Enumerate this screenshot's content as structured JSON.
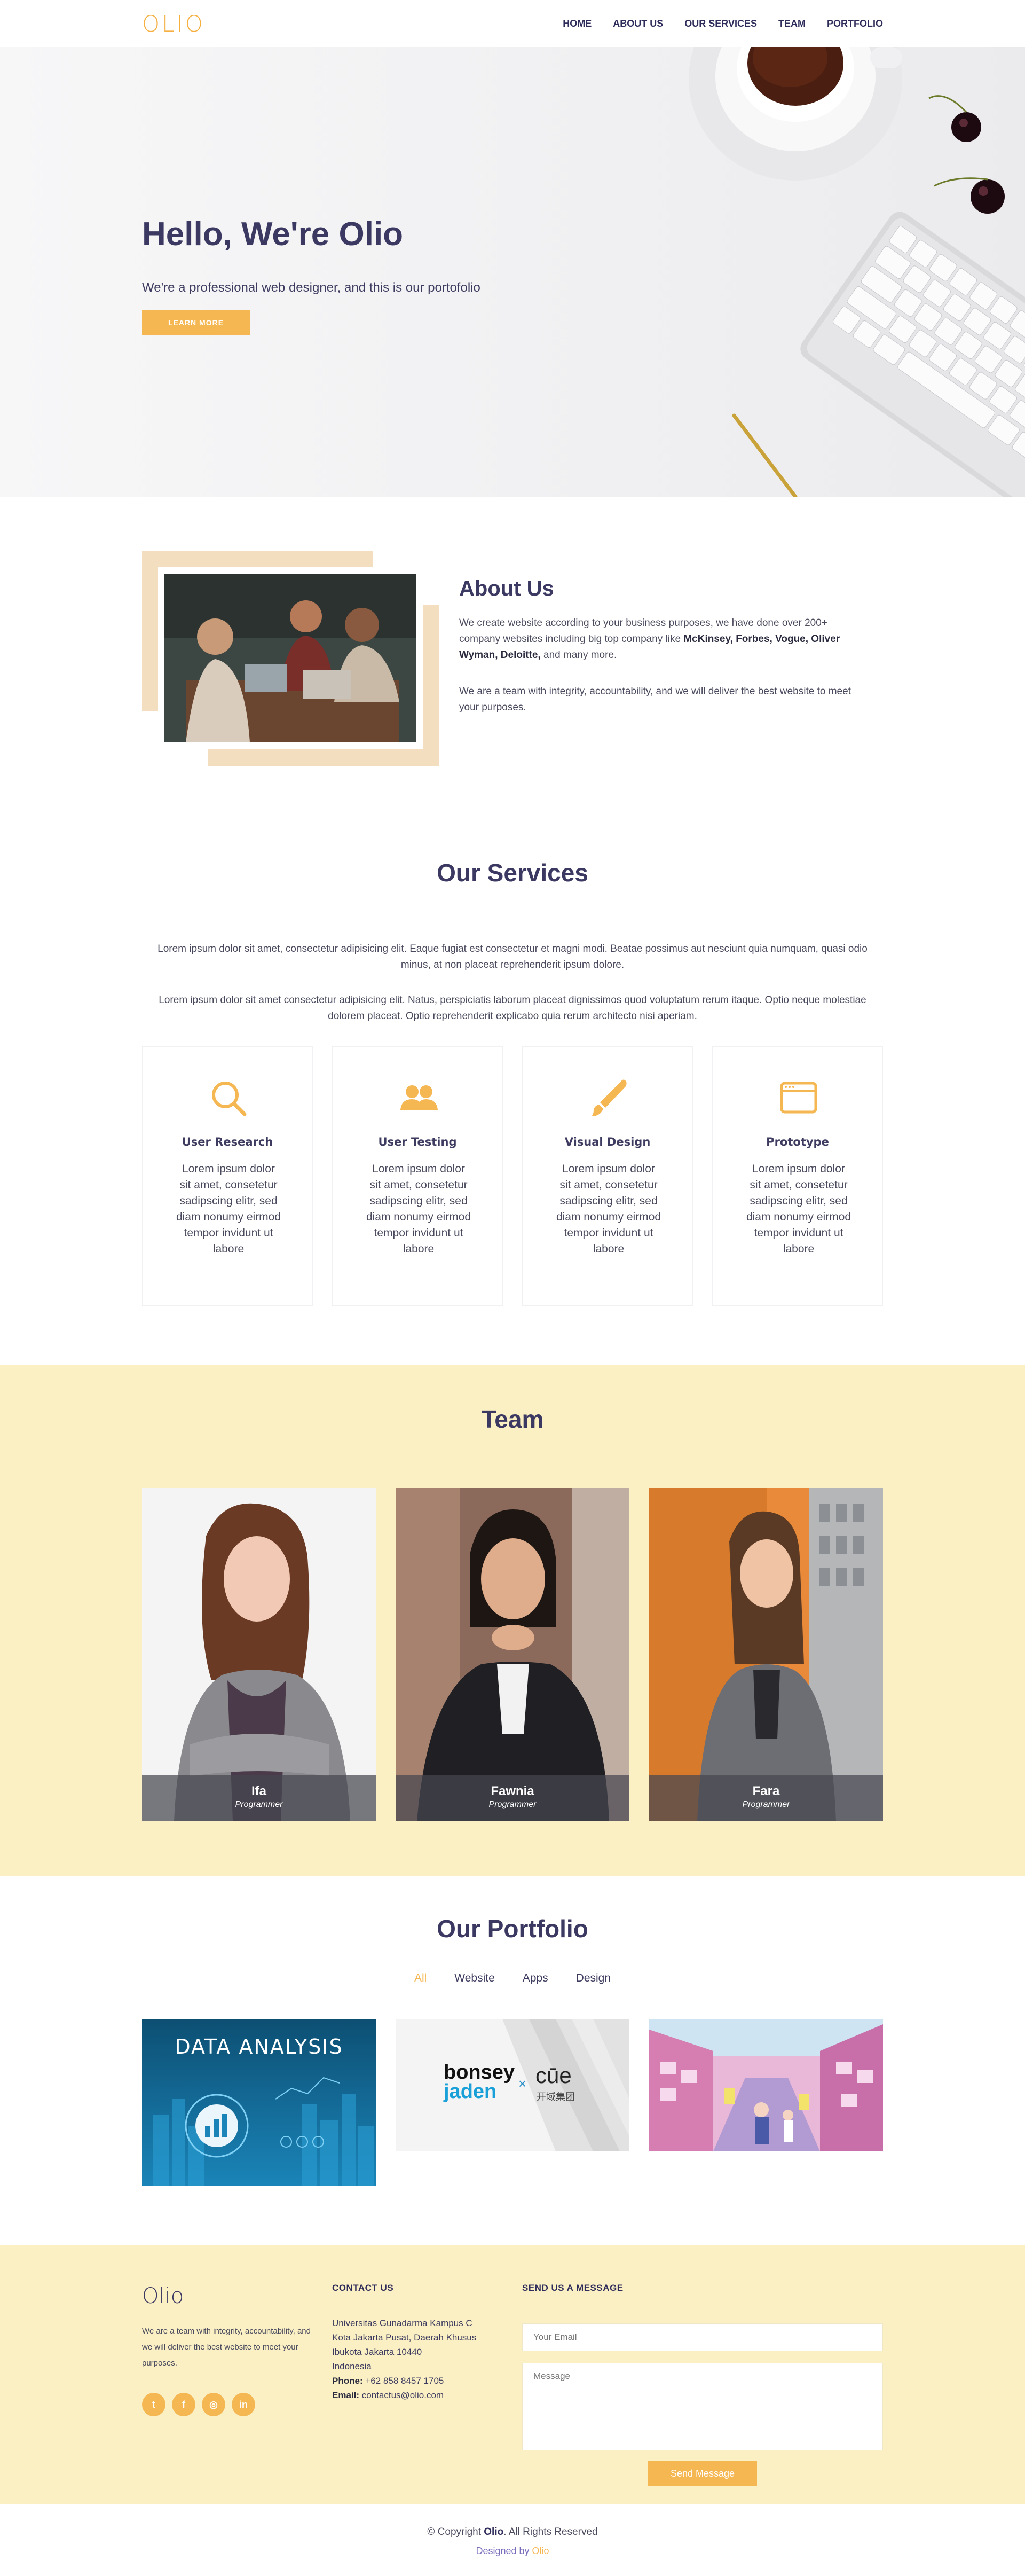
{
  "nav": {
    "logo": "OLIO",
    "links": [
      "HOME",
      "ABOUT US",
      "OUR SERVICES",
      "TEAM",
      "PORTFOLIO"
    ]
  },
  "hero": {
    "title": "Hello, We're Olio",
    "subtitle": "We're a professional web designer, and this is our portofolio",
    "button": "LEARN MORE"
  },
  "about": {
    "title": "About Us",
    "p1_start": "We create website according to your business purposes, we have done over 200+ company websites including big top company like ",
    "p1_bold": "McKinsey, Forbes, Vogue, Oliver Wyman, Deloitte,",
    "p1_end": " and many more.",
    "p2": "We are a team with integrity, accountability, and we will deliver the best website to meet your purposes."
  },
  "services": {
    "title": "Our Services",
    "p1": "Lorem ipsum dolor sit amet, consectetur adipisicing elit. Eaque fugiat est consectetur et magni modi. Beatae possimus aut nesciunt quia numquam, quasi odio minus, at non placeat reprehenderit ipsum dolore.",
    "p2": "Lorem ipsum dolor sit amet consectetur adipisicing elit. Natus, perspiciatis laborum placeat dignissimos quod voluptatum rerum itaque. Optio neque molestiae dolorem placeat. Optio reprehenderit explicabo quia rerum architecto nisi aperiam.",
    "cards": [
      {
        "name": "User Research",
        "icon": "search-icon",
        "text": "Lorem ipsum dolor sit amet, consetetur sadipscing elitr, sed diam nonumy eirmod tempor invidunt ut labore"
      },
      {
        "name": "User Testing",
        "icon": "users-icon",
        "text": "Lorem ipsum dolor sit amet, consetetur sadipscing elitr, sed diam nonumy eirmod tempor invidunt ut labore"
      },
      {
        "name": "Visual Design",
        "icon": "brush-icon",
        "text": "Lorem ipsum dolor sit amet, consetetur sadipscing elitr, sed diam nonumy eirmod tempor invidunt ut labore"
      },
      {
        "name": "Prototype",
        "icon": "browser-window-icon",
        "text": "Lorem ipsum dolor sit amet, consetetur sadipscing elitr, sed diam nonumy eirmod tempor invidunt ut labore"
      }
    ]
  },
  "team": {
    "title": "Team",
    "members": [
      {
        "name": "Ifa",
        "role": "Programmer"
      },
      {
        "name": "Fawnia",
        "role": "Programmer"
      },
      {
        "name": "Fara",
        "role": "Programmer"
      }
    ]
  },
  "portfolio": {
    "title": "Our Portfolio",
    "filters": [
      "All",
      "Website",
      "Apps",
      "Design"
    ],
    "active_filter": "All",
    "items": [
      {
        "caption": "DATA ANALYSIS"
      },
      {
        "logo_left_top": "bonsey",
        "logo_left_bottom": "jaden",
        "times": "×",
        "logo_right": "cūe",
        "logo_right_sub": "开域集团"
      },
      {
        "caption": ""
      }
    ]
  },
  "footer": {
    "logo": "Olio",
    "about": "We are a team with integrity, accountability, and we will deliver the best website to meet your purposes.",
    "social": [
      "twitter-icon",
      "facebook-icon",
      "instagram-icon",
      "linkedin-icon"
    ],
    "social_glyphs": [
      "t",
      "f",
      "◎",
      "in"
    ],
    "contact_heading": "CONTACT US",
    "address": [
      "Universitas Gunadarma Kampus C",
      "Kota Jakarta Pusat, Daerah Khusus",
      "Ibukota Jakarta 10440",
      "Indonesia"
    ],
    "phone_label": "Phone:",
    "phone": "+62 858 8457 1705",
    "email_label": "Email:",
    "email": "contactus@olio.com",
    "message_heading": "SEND US A MESSAGE",
    "email_placeholder": "Your Email",
    "message_placeholder": "Message",
    "send_button": "Send Message"
  },
  "copyright": {
    "prefix": "© Copyright ",
    "brand": "Olio",
    "suffix": ". All Rights Reserved",
    "designed_prefix": "Designed by ",
    "designed_brand": "Olio"
  },
  "colors": {
    "accent": "#f5b752",
    "heading": "#3b3862",
    "cream": "#fbf0c4",
    "frame": "#f3dfbf"
  }
}
